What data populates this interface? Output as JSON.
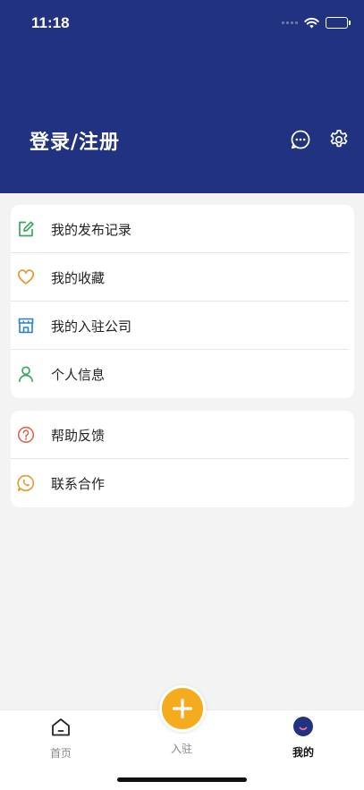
{
  "status_bar": {
    "time": "11:18"
  },
  "header": {
    "login_label": "登录/注册"
  },
  "menu_group_1": [
    {
      "label": "我的发布记录",
      "icon": "edit-icon",
      "color": "#3aa862"
    },
    {
      "label": "我的收藏",
      "icon": "heart-icon",
      "color": "#e39a2e"
    },
    {
      "label": "我的入驻公司",
      "icon": "store-icon",
      "color": "#2b7fc9"
    },
    {
      "label": "个人信息",
      "icon": "user-icon",
      "color": "#3aa862"
    }
  ],
  "menu_group_2": [
    {
      "label": "帮助反馈",
      "icon": "help-icon",
      "color": "#e0664f"
    },
    {
      "label": "联系合作",
      "icon": "phone-chat-icon",
      "color": "#e39a2e"
    }
  ],
  "tabbar": {
    "home": "首页",
    "join": "入驻",
    "mine": "我的",
    "active": "mine"
  },
  "colors": {
    "header_bg": "#213280",
    "accent": "#f4ab1e"
  }
}
